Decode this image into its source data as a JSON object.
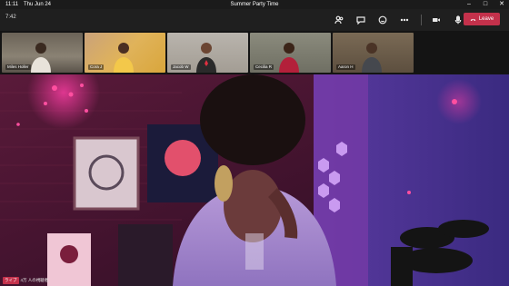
{
  "os_bar": {
    "time": "11:11",
    "date": "Thu Jun 24",
    "window_title": "Summer Party Time"
  },
  "meeting": {
    "elapsed": "7:42",
    "leave_label": "Leave"
  },
  "toolbar_icons": [
    "people-icon",
    "chat-icon",
    "reactions-icon",
    "more-icon",
    "camera-icon",
    "mic-icon",
    "share-icon"
  ],
  "participants": [
    {
      "name": "Miles Holler"
    },
    {
      "name": "Cora J"
    },
    {
      "name": "Jacob W"
    },
    {
      "name": "Cecilia R"
    },
    {
      "name": "Aaron H"
    }
  ],
  "main_caption": {
    "tag": "ライブ",
    "text": "4万 人の視聴者"
  },
  "colors": {
    "leave": "#c4314b",
    "toolbar": "#1f1f1f",
    "strip": "#141414"
  }
}
